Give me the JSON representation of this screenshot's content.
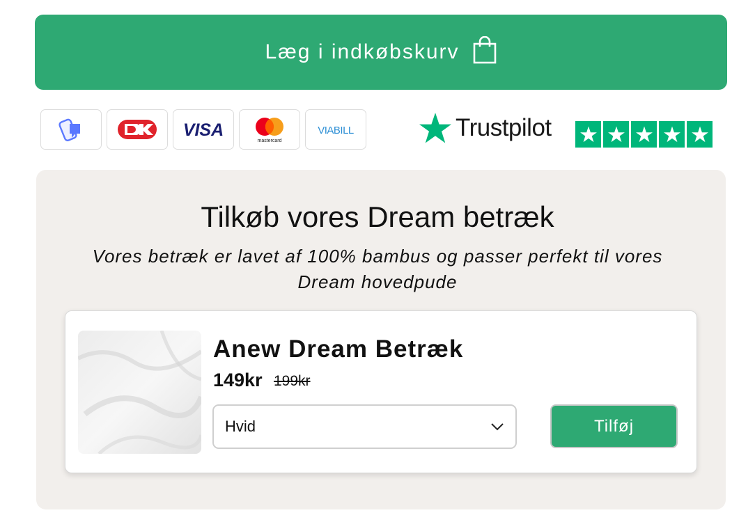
{
  "add_to_cart": {
    "label": "Læg i indkøbskurv",
    "icon": "shopping-bag-icon"
  },
  "payment_methods": [
    {
      "name": "MobilePay",
      "icon": "mobilepay-logo"
    },
    {
      "name": "Dankort",
      "icon": "dankort-logo"
    },
    {
      "name": "VISA",
      "icon": "visa-logo"
    },
    {
      "name": "mastercard",
      "icon": "mastercard-logo"
    },
    {
      "name": "VIABILL",
      "icon": "viabill-logo"
    }
  ],
  "trustpilot": {
    "label": "Trustpilot",
    "stars": 5,
    "color": "#00b67a"
  },
  "upsell": {
    "title": "Tilkøb vores Dream betræk",
    "subtitle": "Vores betræk er lavet af 100% bambus og passer perfekt til vores Dream hovedpude",
    "product": {
      "name": "Anew Dream Betræk",
      "price": "149kr",
      "old_price": "199kr",
      "variant": "Hvid",
      "add_label": "Tilføj"
    }
  },
  "colors": {
    "accent": "#2ea973",
    "panel": "#f2efec"
  }
}
